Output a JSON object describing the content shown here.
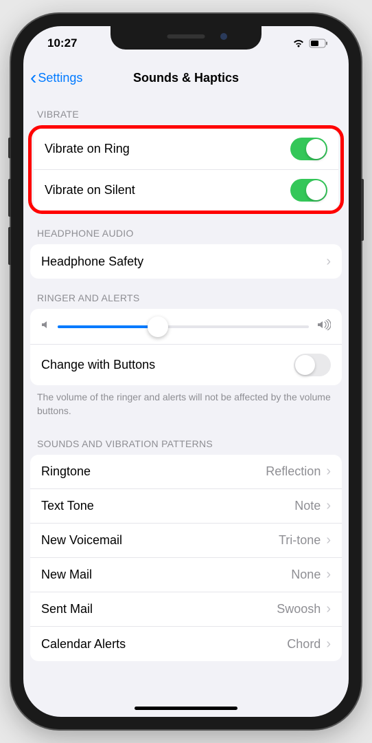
{
  "status": {
    "time": "10:27"
  },
  "nav": {
    "back_label": "Settings",
    "title": "Sounds & Haptics"
  },
  "sections": {
    "vibrate": {
      "header": "VIBRATE",
      "rows": [
        {
          "label": "Vibrate on Ring",
          "toggle": true
        },
        {
          "label": "Vibrate on Silent",
          "toggle": true
        }
      ]
    },
    "headphone": {
      "header": "HEADPHONE AUDIO",
      "row": {
        "label": "Headphone Safety"
      }
    },
    "ringer": {
      "header": "RINGER AND ALERTS",
      "slider_value": 40,
      "change_label": "Change with Buttons",
      "change_toggle": false,
      "footer": "The volume of the ringer and alerts will not be affected by the volume buttons."
    },
    "patterns": {
      "header": "SOUNDS AND VIBRATION PATTERNS",
      "rows": [
        {
          "label": "Ringtone",
          "value": "Reflection"
        },
        {
          "label": "Text Tone",
          "value": "Note"
        },
        {
          "label": "New Voicemail",
          "value": "Tri-tone"
        },
        {
          "label": "New Mail",
          "value": "None"
        },
        {
          "label": "Sent Mail",
          "value": "Swoosh"
        },
        {
          "label": "Calendar Alerts",
          "value": "Chord"
        }
      ]
    }
  }
}
